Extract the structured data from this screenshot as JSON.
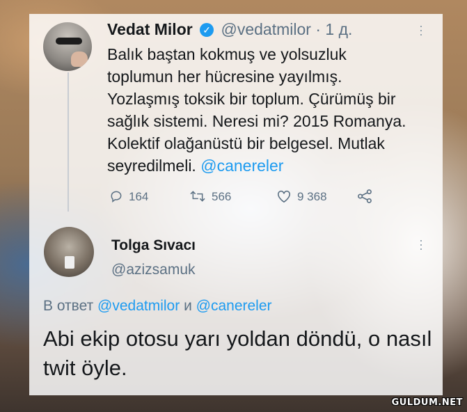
{
  "tweet": {
    "author_name": "Vedat Milor",
    "handle": "@vedatmilor",
    "separator": "·",
    "time": "1 д.",
    "text_lines": [
      "Balık baştan kokmuş ve yolsuzluk",
      "toplumun her hücresine yayılmış.",
      "Yozlaşmış toksik bir toplum. Çürümüş bir",
      "sağlık sistemi. Neresi mi? 2015 Romanya.",
      "Kolektif olağanüstü bir belgesel. Mutlak",
      "seyredilmeli."
    ],
    "mention": "@canereler",
    "replies": "164",
    "retweets": "566",
    "likes": "9 368",
    "more_icon": "more-vertical-icon",
    "verified_icon": "verified-badge-icon"
  },
  "reply": {
    "author_name": "Tolga Sıvacı",
    "handle": "@azizsamuk",
    "reply_to_prefix": "В ответ",
    "reply_to_mention1": "@vedatmilor",
    "reply_to_conj": "и",
    "reply_to_mention2": "@canereler",
    "text": "Abi ekip otosu yarı yoldan döndü, o nasıl twit öyle."
  },
  "watermark": "GULDUM.NET",
  "colors": {
    "accent": "#1d9bf0",
    "text": "#14171a",
    "secondary": "#5b7083"
  }
}
